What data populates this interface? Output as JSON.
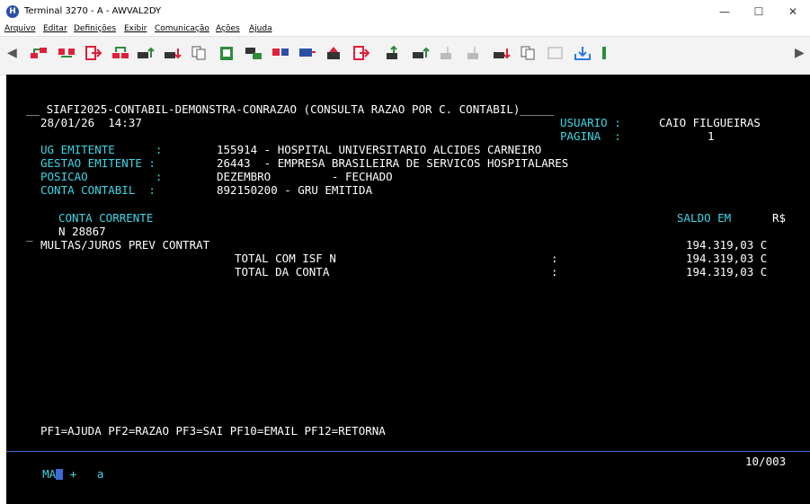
{
  "window": {
    "title": "Terminal 3270 - A - AWVAL2DY",
    "app_icon_letter": "H",
    "minimize": "—",
    "maximize": "☐",
    "close": "✕"
  },
  "menu": [
    "Arquivo",
    "Editar",
    "Definições",
    "Exibir",
    "Comunicação",
    "Ações",
    "Ajuda"
  ],
  "toolbar": {
    "left_arrow": "◀",
    "right_arrow": "▶"
  },
  "screen": {
    "header_title": "__ SIAFI2025-CONTABIL-DEMONSTRA-CONRAZAO (CONSULTA RAZAO POR C. CONTABIL)_____",
    "date_time": "28/01/26  14:37",
    "usuario_label": "USUARIO :",
    "usuario_value": "CAIO FILGUEIRAS",
    "pagina_label": "PAGINA  :",
    "pagina_value": "1",
    "ug_label": "UG EMITENTE      :",
    "ug_value": "155914 - HOSPITAL UNIVERSITARIO ALCIDES CARNEIRO",
    "gestao_label": "GESTAO EMITENTE :",
    "gestao_value": "26443  - EMPRESA BRASILEIRA DE SERVICOS HOSPITALARES",
    "posicao_label": "POSICAO          :",
    "posicao_value": "DEZEMBRO         - FECHADO",
    "conta_label": "CONTA CONTABIL  :",
    "conta_value": "892150200 - GRU EMITIDA",
    "conta_corrente_label": "CONTA CORRENTE",
    "saldo_label": "SALDO EM",
    "currency": "R$",
    "entry_marker": "_",
    "entry_code": "N 28867",
    "entry_desc": "MULTAS/JUROS PREV CONTRAT",
    "entry_value": "194.319,03 C",
    "total_isf_label": "TOTAL COM ISF N",
    "total_isf_colon": ":",
    "total_isf_value": "194.319,03 C",
    "total_conta_label": "TOTAL DA CONTA",
    "total_conta_colon": ":",
    "total_conta_value": "194.319,03 C",
    "pf_keys": "PF1=AJUDA PF2=RAZAO PF3=SAI PF10=EMAIL PF12=RETORNA"
  },
  "status": {
    "mode": "MA",
    "plus": "+",
    "session": "a",
    "position": "10/003"
  },
  "colors": {
    "background": "#000000",
    "cyan": "#3cd6e6",
    "white": "#ffffff",
    "status_line": "#3a6bd8"
  }
}
